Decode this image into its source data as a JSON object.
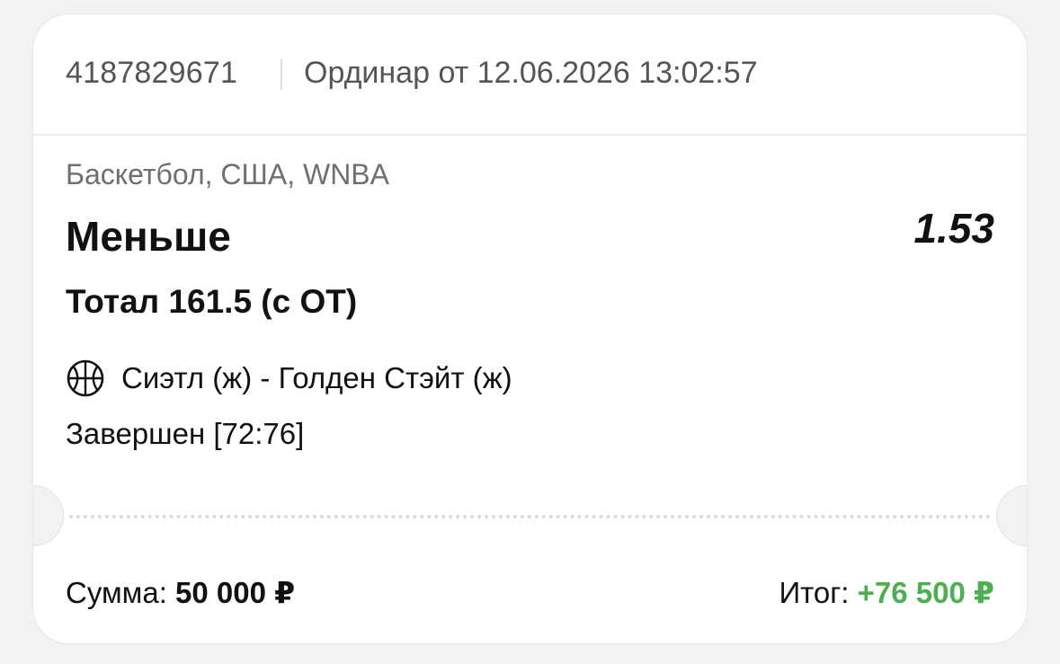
{
  "header": {
    "bet_id": "4187829671",
    "bet_type": "Ординар от 12.06.2026 13:02:57"
  },
  "event": {
    "sport_path": "Баскетбол, США, WNBA",
    "outcome": "Меньше",
    "odds": "1.53",
    "market": "Тотал 161.5 (с ОТ)",
    "match": "Сиэтл (ж) - Голден Стэйт (ж)",
    "sport_icon": "basketball-icon",
    "status": "Завершен [72:76]"
  },
  "footer": {
    "sum_label": "Сумма:",
    "sum_value": "50 000 ₽",
    "total_label": "Итог:",
    "total_value": "+76 500 ₽"
  },
  "colors": {
    "win": "#4caf50",
    "background": "#f2f2f2",
    "card": "#ffffff"
  }
}
